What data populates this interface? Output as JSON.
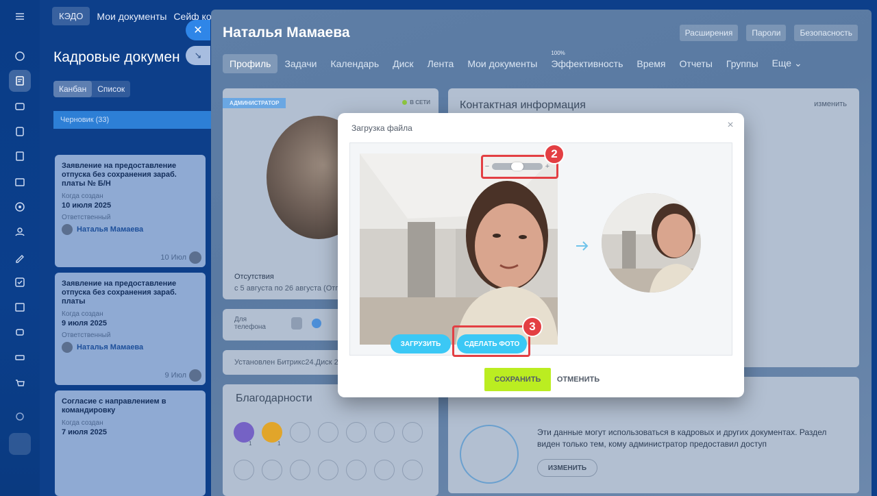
{
  "app": {
    "top_tabs": [
      "КЭДО",
      "Мои документы",
      "Сейф ко"
    ],
    "page_title": "Кадровые докумен",
    "view_tabs": [
      "Канбан",
      "Список"
    ],
    "column_header": "Черновик (33)",
    "cards": [
      {
        "title": "Заявление на предоставление отпуска без сохранения зараб. платы № Б/Н",
        "created_label": "Когда создан",
        "created": "10 июля 2025",
        "resp_label": "Ответственный",
        "user": "Наталья Мамаева",
        "date": "10 Июл"
      },
      {
        "title": "Заявление на предоставление отпуска без сохранения зараб. платы",
        "created_label": "Когда создан",
        "created": "9 июля 2025",
        "resp_label": "Ответственный",
        "user": "Наталья Мамаева",
        "date": "9 Июл"
      },
      {
        "title": "Согласие с направлением в командировку",
        "created_label": "Когда создан",
        "created": "7 июля 2025",
        "resp_label": "",
        "user": "",
        "date": ""
      }
    ]
  },
  "profile": {
    "name": "Наталья Мамаева",
    "top_buttons": [
      "Расширения",
      "Пароли",
      "Безопасность"
    ],
    "tabs": [
      "Профиль",
      "Задачи",
      "Календарь",
      "Диск",
      "Лента",
      "Мои документы",
      "Эффективность",
      "Время",
      "Отчеты",
      "Группы",
      "Еще"
    ],
    "efficiency_percent": "100%",
    "badge_admin": "АДМИНИСТРАТОР",
    "status_online": "В СЕТИ",
    "absence_label": "Отсутствия",
    "absence_value": "с 5 августа по 26 августа (Отпус",
    "for_phone": "Для телефона",
    "installed": "Установлен Битрикс24.Диск 25.",
    "thanks_title": "Благодарности",
    "thanks_counts": [
      "1",
      "1"
    ],
    "contact_title": "Контактная информация",
    "contact_edit": "изменить",
    "hr_text": "Эти данные могут использоваться в кадровых и других документах. Раздел виден только тем, кому администратор предоставил доступ",
    "hr_edit_button": "ИЗМЕНИТЬ"
  },
  "dialog": {
    "title": "Загрузка файла",
    "upload_button": "ЗАГРУЗИТЬ",
    "photo_button": "СДЕЛАТЬ ФОТО",
    "save_button": "СОХРАНИТЬ",
    "cancel_button": "ОТМЕНИТЬ",
    "zoom_level": 0.5
  },
  "markers": [
    "2",
    "3"
  ],
  "colors": {
    "accent_blue": "#3bc8f5",
    "save_green": "#bbed21",
    "highlight_red": "#e33f43"
  }
}
